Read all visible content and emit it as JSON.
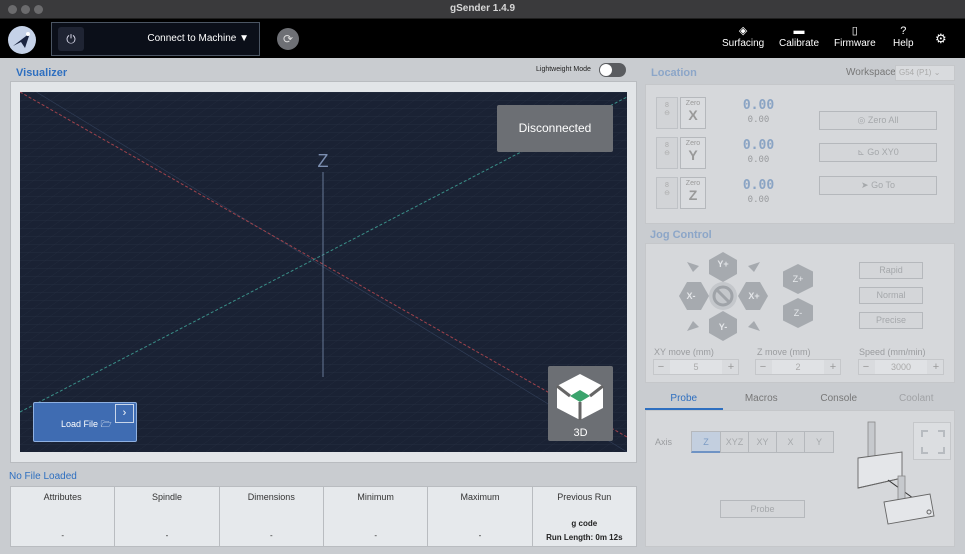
{
  "window": {
    "title": "gSender 1.4.9"
  },
  "header": {
    "connect_label": "Connect to Machine ▼",
    "nav": [
      {
        "label": "Surfacing",
        "icon": "surfacing-icon"
      },
      {
        "label": "Calibrate",
        "icon": "calibrate-icon"
      },
      {
        "label": "Firmware",
        "icon": "firmware-icon"
      },
      {
        "label": "Help",
        "icon": "help-icon"
      }
    ]
  },
  "visualizer": {
    "title": "Visualizer",
    "lightweight_label": "Lightweight Mode",
    "lightweight_on": false,
    "status": "Disconnected",
    "axis_label": "Z",
    "load_file_label": "Load File",
    "view_label": "3D"
  },
  "file_info": {
    "title": "No File Loaded",
    "columns": [
      {
        "header": "Attributes",
        "value": "-"
      },
      {
        "header": "Spindle",
        "value": "-"
      },
      {
        "header": "Dimensions",
        "value": "-"
      },
      {
        "header": "Minimum",
        "value": "-"
      },
      {
        "header": "Maximum",
        "value": "-"
      },
      {
        "header": "Previous Run",
        "value": "g code",
        "value2": "Run Length: 0m 12s"
      }
    ]
  },
  "location": {
    "title": "Location",
    "workspace_label": "Workspace:",
    "workspace_value": "G54 (P1)",
    "zero_label": "Zero",
    "axes": [
      {
        "axis": "X",
        "main": "0.00",
        "sub": "0.00"
      },
      {
        "axis": "Y",
        "main": "0.00",
        "sub": "0.00"
      },
      {
        "axis": "Z",
        "main": "0.00",
        "sub": "0.00"
      }
    ],
    "buttons": {
      "zero_all": "Zero All",
      "go_xy0": "Go XY0",
      "go_to": "Go To"
    }
  },
  "jog": {
    "title": "Jog Control",
    "labels": {
      "y_plus": "Y+",
      "y_minus": "Y-",
      "x_plus": "X+",
      "x_minus": "X-",
      "z_plus": "Z+",
      "z_minus": "Z-"
    },
    "speeds": [
      "Rapid",
      "Normal",
      "Precise"
    ],
    "xy_move_label": "XY move (mm)",
    "xy_move_value": "5",
    "z_move_label": "Z move (mm)",
    "z_move_value": "2",
    "speed_label": "Speed (mm/min)",
    "speed_value": "3000"
  },
  "tabs": [
    "Probe",
    "Macros",
    "Console",
    "Coolant"
  ],
  "probe": {
    "axis_label": "Axis",
    "axis_options": [
      "Z",
      "XYZ",
      "XY",
      "X",
      "Y"
    ],
    "selected": "Z",
    "probe_label": "Probe"
  },
  "colors": {
    "accent": "#2e6fc0",
    "canvas_bg": "#1a2234",
    "header_bg": "#000000"
  }
}
